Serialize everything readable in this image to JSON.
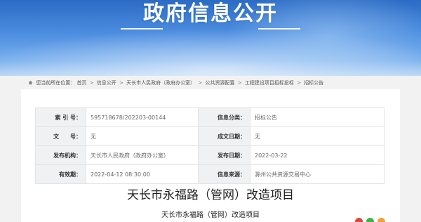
{
  "banner": {
    "title": "政府信息公开"
  },
  "breadcrumb": {
    "prefix": "您当前所在位置：",
    "items": [
      "首页",
      "信息公开",
      "天长市人民政府（政府办公室）",
      "公共资源配置",
      "工程建设项目招标投标",
      "招标公告"
    ],
    "separator": ">"
  },
  "meta": {
    "rows": [
      {
        "label1": "索 引 号：",
        "value1": "595718678/202203-00144",
        "label2": "信息分类：",
        "value2": "招标公告"
      },
      {
        "label1": "文　　号：",
        "value1": "无",
        "label2": "成文日期：",
        "value2": "无"
      },
      {
        "label1": "发布机构：",
        "value1": "天长市人民政府（政府办公室）",
        "label2": "发布日期：",
        "value2": "2022-03-22"
      },
      {
        "label1": "有效期：",
        "value1": "2022-04-12 08:30:00",
        "label2": "信息来源：",
        "value2": "滁州公共资源交易中心"
      }
    ]
  },
  "document": {
    "title": "天长市永福路（管网）改造项目",
    "subtitle": "天长市永福路（管网）改造项目"
  },
  "colors": {
    "banner_blue": "#2b6bc5",
    "share_red": "#e0463a",
    "share_green": "#3fb24a",
    "share_orange": "#f0a03a"
  },
  "icons": {
    "home": "home-icon"
  }
}
